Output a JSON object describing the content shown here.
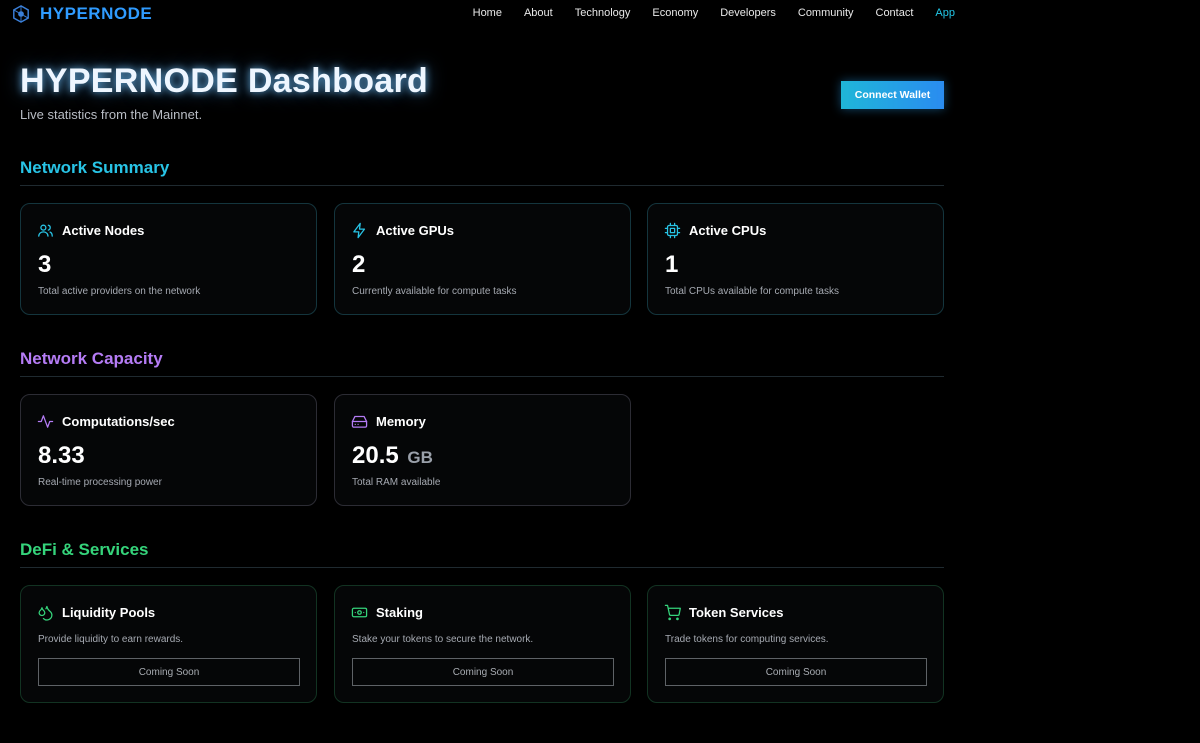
{
  "brand": {
    "name": "HYPERNODE",
    "logo_icon": "hypernode-logo-icon",
    "color": "#2f9bff"
  },
  "nav": {
    "links": [
      {
        "label": "Home"
      },
      {
        "label": "About"
      },
      {
        "label": "Technology"
      },
      {
        "label": "Economy"
      },
      {
        "label": "Developers"
      },
      {
        "label": "Community"
      },
      {
        "label": "Contact"
      },
      {
        "label": "App",
        "active": true
      }
    ]
  },
  "header": {
    "title": "HYPERNODE Dashboard",
    "subtitle": "Live statistics from the Mainnet.",
    "connect_label": "Connect Wallet"
  },
  "sections": {
    "summary": {
      "title": "Network Summary",
      "color": "#28c4e6",
      "cards": [
        {
          "icon": "users-icon",
          "label": "Active Nodes",
          "value": "3",
          "desc": "Total active providers on the network"
        },
        {
          "icon": "zap-icon",
          "label": "Active GPUs",
          "value": "2",
          "desc": "Currently available for compute tasks"
        },
        {
          "icon": "cpu-icon",
          "label": "Active CPUs",
          "value": "1",
          "desc": "Total CPUs available for compute tasks"
        }
      ]
    },
    "capacity": {
      "title": "Network Capacity",
      "color": "#b57cf5",
      "cards": [
        {
          "icon": "activity-icon",
          "label": "Computations/sec",
          "value": "8.33",
          "desc": "Real-time processing power"
        },
        {
          "icon": "hard-drive-icon",
          "label": "Memory",
          "value": "20.5",
          "unit": "GB",
          "desc": "Total RAM available"
        }
      ]
    },
    "defi": {
      "title": "DeFi & Services",
      "color": "#35d47b",
      "cards": [
        {
          "icon": "droplets-icon",
          "label": "Liquidity Pools",
          "desc": "Provide liquidity to earn rewards.",
          "button": "Coming Soon"
        },
        {
          "icon": "banknote-icon",
          "label": "Staking",
          "desc": "Stake your tokens to secure the network.",
          "button": "Coming Soon"
        },
        {
          "icon": "shopping-cart-icon",
          "label": "Token Services",
          "desc": "Trade tokens for computing services.",
          "button": "Coming Soon"
        }
      ]
    }
  }
}
